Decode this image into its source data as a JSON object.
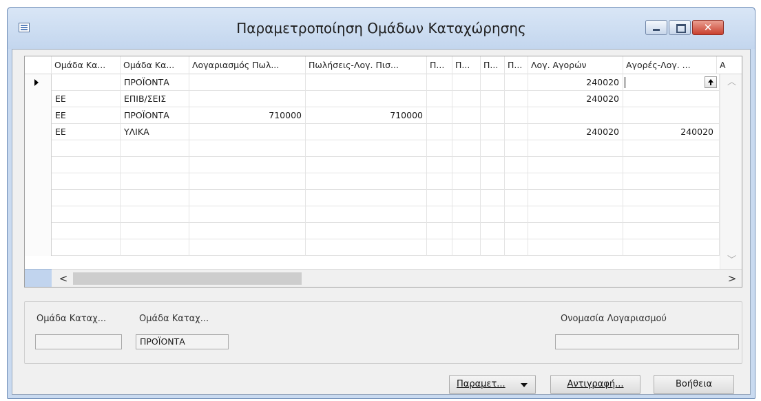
{
  "window": {
    "title": "Παραμετροποίηση Ομάδων Καταχώρησης",
    "minimize_glyph": "–",
    "maximize_glyph": "□",
    "close_glyph": "✕"
  },
  "grid": {
    "columns": [
      "Ομάδα Κα...",
      "Ομάδα Κα...",
      "Λογαριασμός Πωλ...",
      "Πωλήσεις-Λογ. Πισ...",
      "Π...",
      "Π...",
      "Π...",
      "Π...",
      "Λογ. Αγορών",
      "Αγορές-Λογ. ...",
      "Α"
    ],
    "rows": [
      [
        "",
        "ΠΡΟΪΟΝΤΑ",
        "",
        "",
        "",
        "",
        "",
        "",
        "240020",
        "",
        ""
      ],
      [
        "ΕΕ",
        "ΕΠΙΒ/ΣΕΙΣ",
        "",
        "",
        "",
        "",
        "",
        "",
        "240020",
        "",
        ""
      ],
      [
        "ΕΕ",
        "ΠΡΟΪΟΝΤΑ",
        "710000",
        "710000",
        "",
        "",
        "",
        "",
        "",
        "",
        ""
      ],
      [
        "ΕΕ",
        "ΥΛΙΚΑ",
        "",
        "",
        "",
        "",
        "",
        "",
        "240020",
        "240020",
        ""
      ],
      [
        "",
        "",
        "",
        "",
        "",
        "",
        "",
        "",
        "",
        "",
        ""
      ],
      [
        "",
        "",
        "",
        "",
        "",
        "",
        "",
        "",
        "",
        "",
        ""
      ],
      [
        "",
        "",
        "",
        "",
        "",
        "",
        "",
        "",
        "",
        "",
        ""
      ],
      [
        "",
        "",
        "",
        "",
        "",
        "",
        "",
        "",
        "",
        "",
        ""
      ],
      [
        "",
        "",
        "",
        "",
        "",
        "",
        "",
        "",
        "",
        "",
        ""
      ],
      [
        "",
        "",
        "",
        "",
        "",
        "",
        "",
        "",
        "",
        "",
        ""
      ],
      [
        "",
        "",
        "",
        "",
        "",
        "",
        "",
        "",
        "",
        "",
        ""
      ]
    ],
    "active_row": 0,
    "scroll_up_glyph": "︿",
    "scroll_down_glyph": "﹀",
    "scroll_left_glyph": "<",
    "scroll_right_glyph": ">"
  },
  "detail": {
    "label_1": "Ομάδα Καταχ...",
    "value_1": "",
    "label_2": "Ομάδα Καταχ...",
    "value_2": "ΠΡΟΪΟΝΤΑ",
    "label_3": "Ονομασία Λογαριασμού",
    "value_3": ""
  },
  "buttons": {
    "functions": "Παραμετ...",
    "copy": "Αντιγραφή...",
    "help": "Βοήθεια"
  },
  "icons": {
    "app": "table-form-icon",
    "row_indicator": "row-pointer-icon",
    "lookup": "lookup-arrow-icon",
    "dropdown": "caret-down-icon"
  }
}
